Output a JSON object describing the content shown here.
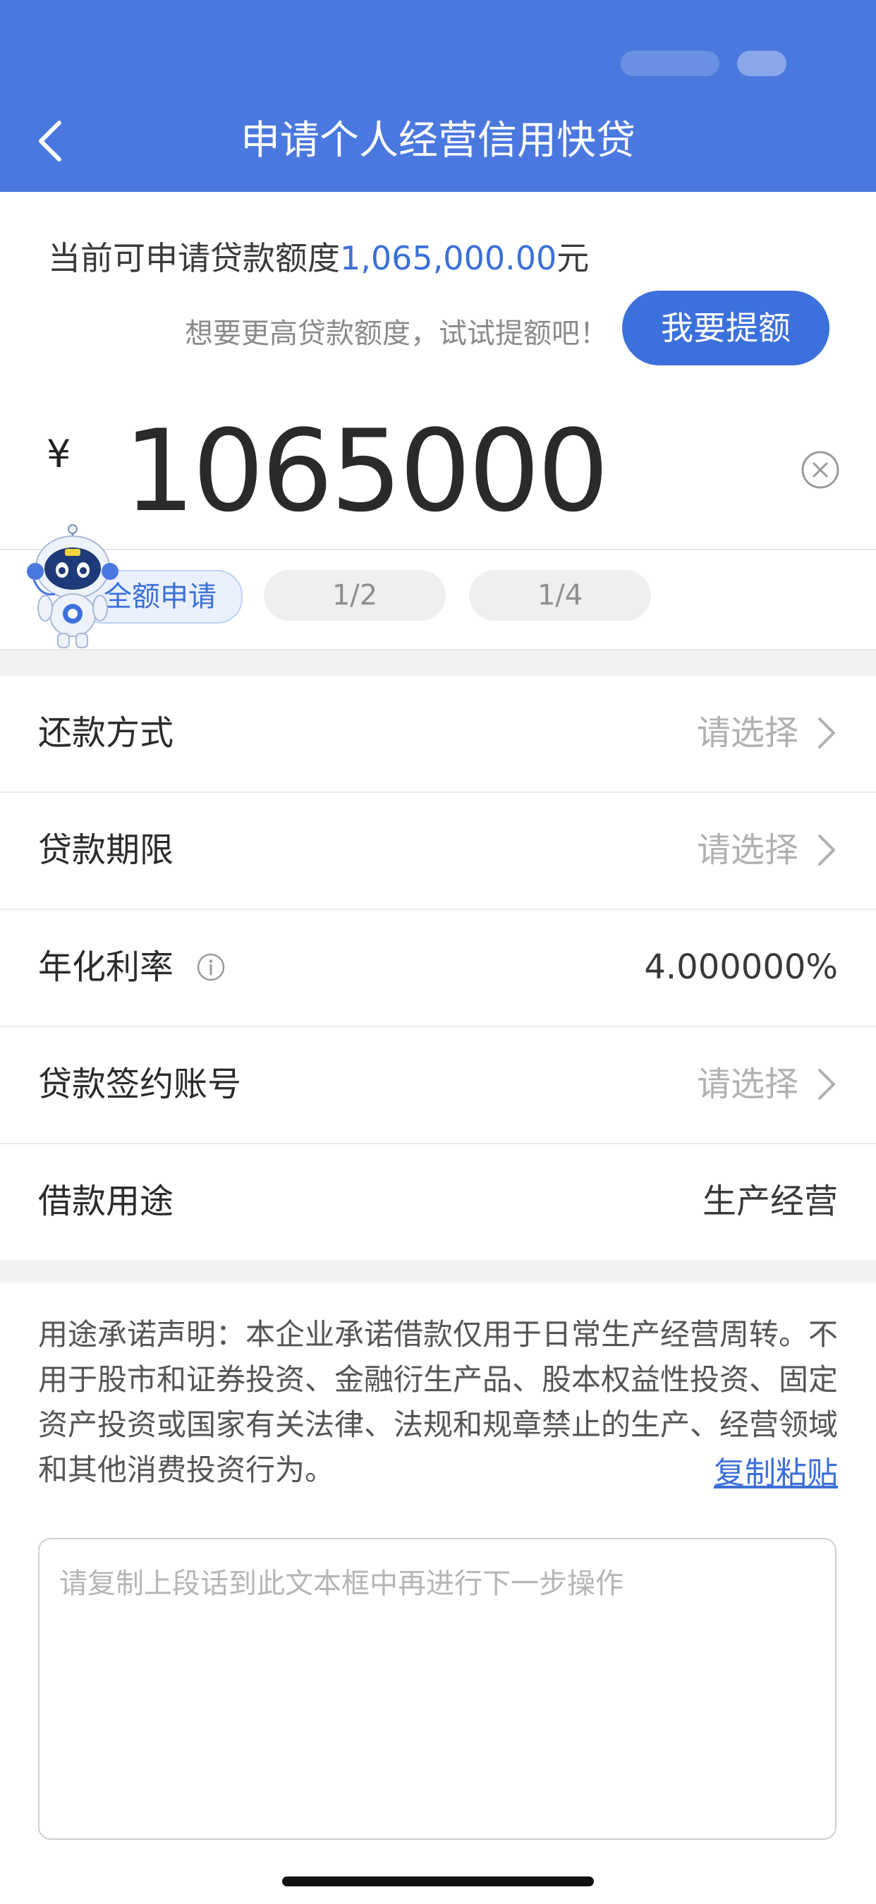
{
  "header": {
    "title": "申请个人经营信用快贷",
    "back_icon": "chevron-left-icon",
    "background_color": "#4a78de"
  },
  "quota": {
    "prefix": "当前可申请贷款额度",
    "amount": "1,065,000.00",
    "unit": "元",
    "amount_color": "#3c70d8"
  },
  "raise": {
    "hint": "想要更高贷款额度，试试提额吧！",
    "button_label": "我要提额"
  },
  "amount": {
    "currency": "¥",
    "value": "1065000",
    "clear_icon": "clear-circle-icon"
  },
  "chips": [
    {
      "label": "全额申请",
      "selected": true
    },
    {
      "label": "1/2",
      "selected": false
    },
    {
      "label": "1/4",
      "selected": false
    }
  ],
  "form": {
    "repayment": {
      "label": "还款方式",
      "placeholder": "请选择"
    },
    "term": {
      "label": "贷款期限",
      "placeholder": "请选择"
    },
    "rate": {
      "label": "年化利率",
      "value": "4.000000%",
      "icon": "info-icon"
    },
    "account": {
      "label": "贷款签约账号",
      "placeholder": "请选择"
    },
    "purpose": {
      "label": "借款用途",
      "value": "生产经营"
    }
  },
  "statement": {
    "text": "用途承诺声明：本企业承诺借款仅用于日常生产经营周转。不用于股市和证券投资、金融衍生产品、股本权益性投资、固定资产投资或国家有关法律、法规和规章禁止的生产、经营领域和其他消费投资行为。",
    "copy_link": "复制粘贴"
  },
  "input": {
    "placeholder": "请复制上段话到此文本框中再进行下一步操作"
  }
}
